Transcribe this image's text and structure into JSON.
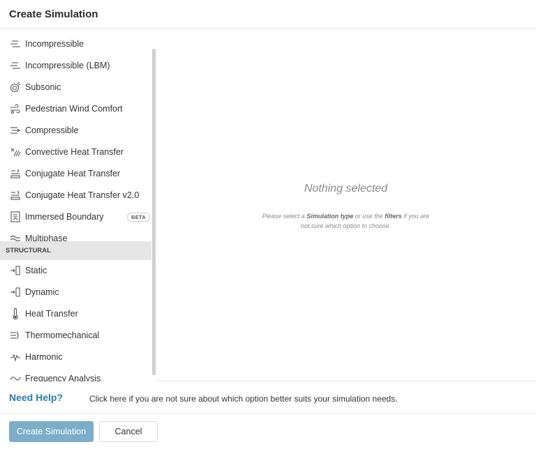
{
  "header": {
    "title": "Create Simulation"
  },
  "fluids": [
    {
      "label": "Incompressible",
      "icon": "incompressible-icon"
    },
    {
      "label": "Incompressible (LBM)",
      "icon": "incompressible-lbm-icon"
    },
    {
      "label": "Subsonic",
      "icon": "subsonic-icon"
    },
    {
      "label": "Pedestrian Wind Comfort",
      "icon": "wind-icon"
    },
    {
      "label": "Compressible",
      "icon": "compressible-icon"
    },
    {
      "label": "Convective Heat Transfer",
      "icon": "convective-heat-icon"
    },
    {
      "label": "Conjugate Heat Transfer",
      "icon": "conjugate-heat-icon"
    },
    {
      "label": "Conjugate Heat Transfer v2.0",
      "icon": "conjugate-heat-v2-icon"
    },
    {
      "label": "Immersed Boundary",
      "icon": "immersed-boundary-icon",
      "badge": "BETA"
    },
    {
      "label": "Multiphase",
      "icon": "multiphase-icon"
    }
  ],
  "structural_header": "STRUCTURAL",
  "structural": [
    {
      "label": "Static",
      "icon": "static-icon"
    },
    {
      "label": "Dynamic",
      "icon": "dynamic-icon"
    },
    {
      "label": "Heat Transfer",
      "icon": "thermometer-icon"
    },
    {
      "label": "Thermomechanical",
      "icon": "thermomechanical-icon"
    },
    {
      "label": "Harmonic",
      "icon": "harmonic-icon"
    },
    {
      "label": "Frequency Analysis",
      "icon": "frequency-icon"
    }
  ],
  "detail": {
    "empty_title": "Nothing selected",
    "msg_part1": "Please select a ",
    "msg_bold1": "Simulation type",
    "msg_part2": " or use the ",
    "msg_bold2": "filters",
    "msg_part3": " if you are not sure which option to choose."
  },
  "help": {
    "title": "Need Help?",
    "text": "Click here if you are not sure about which option better suits your simulation needs."
  },
  "buttons": {
    "create": "Create Simulation",
    "cancel": "Cancel"
  },
  "colors": {
    "primary": "#7cadc9",
    "link": "#2a7dab",
    "section_bg": "#e6e6e6"
  }
}
